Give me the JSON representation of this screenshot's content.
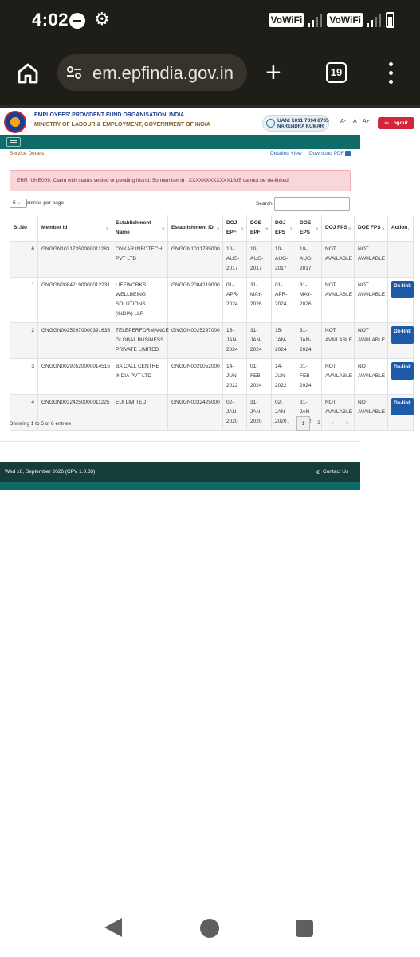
{
  "status_bar": {
    "time": "4:02",
    "network1": "VoWiFi",
    "network2": "VoWiFi"
  },
  "browser": {
    "url": "em.epfindia.gov.in",
    "tab_count": "19"
  },
  "site_header": {
    "org_line1": "EMPLOYEES' PROVIDENT FUND ORGANISATION, INDIA",
    "org_line2": "MINISTRY OF LABOUR & EMPLOYMENT, GOVERNMENT OF INDIA",
    "uan": "UAN: 1011 7094 8705",
    "user_name": "NARENDRA KUMAR",
    "font_small": "A-",
    "font_normal": "A",
    "font_large": "A+",
    "logout": "Logout"
  },
  "page": {
    "title": "Service Details",
    "detailed_view": "Detailed View",
    "download_pdf": "Download PDF",
    "error": "ERR_UNE009: Claim with status settled or pending found. So member id : XXXXXXXXXXXX1635 cannot be de-linked.",
    "entries_value": "5",
    "entries_label": "entries per page",
    "search_label": "Search:",
    "info": "Showing 1 to 5 of 6 entries"
  },
  "table": {
    "headers": {
      "srno": "Sr.No",
      "member_id": "Member Id",
      "est_name": "Establishment Name",
      "est_id": "Establishment ID",
      "doj_epf": "DOJ EPF",
      "doe_epf": "DOE EPF",
      "doj_eps": "DOJ EPS",
      "doe_eps": "DOE EPS",
      "doj_fps": "DOJ FPS",
      "doe_fps": "DOE FPS",
      "action": "Action"
    },
    "delink_label": "De-link",
    "rows": [
      {
        "sr": "6",
        "member_id": "GNGGN10317350000011283",
        "est_name": "ONKAR INFOTECH PVT LTD",
        "est_id": "GNGGN1031735000",
        "doj_epf": "10-AUG-2017",
        "doe_epf": "10-AUG-2017",
        "doj_eps": "10-AUG-2017",
        "doe_eps": "10-AUG-2017",
        "doj_fps": "NOT AVAILABLE",
        "doe_fps": "NOT AVAILABLE"
      },
      {
        "sr": "1",
        "member_id": "GNGGN20842190000012231",
        "est_name": "LIFEWORKS WELLBEING SOLUTIONS (INDIA) LLP",
        "est_id": "GNGGN2084219000",
        "doj_epf": "01-APR-2024",
        "doe_epf": "31-MAY-2026",
        "doj_eps": "01-APR-2024",
        "doe_eps": "31-MAY-2026",
        "doj_fps": "NOT AVAILABLE",
        "doe_fps": "NOT AVAILABLE"
      },
      {
        "sr": "2",
        "member_id": "GNGGN00252970000391635",
        "est_name": "TELEPERFORMANCE GLOBAL BUSINESS PRIVATE LIMITED",
        "est_id": "GNGGN0025297000",
        "doj_epf": "15-JAN-2024",
        "doe_epf": "31-JAN-2024",
        "doj_eps": "15-JAN-2024",
        "doe_eps": "31-JAN-2024",
        "doj_fps": "NOT AVAILABLE",
        "doe_fps": "NOT AVAILABLE"
      },
      {
        "sr": "3",
        "member_id": "GNGGN00290520000014515",
        "est_name": "BA CALL CENTRE INDIA PVT LTD",
        "est_id": "GNGGN0029052000",
        "doj_epf": "14-JUN-2022",
        "doe_epf": "01-FEB-2024",
        "doj_eps": "14-JUN-2022",
        "doe_eps": "01-FEB-2024",
        "doj_fps": "NOT AVAILABLE",
        "doe_fps": "NOT AVAILABLE"
      },
      {
        "sr": "4",
        "member_id": "GNGGN00324250000011225",
        "est_name": "EUI LIMITED",
        "est_id": "GNGGN0032425000",
        "doj_epf": "02-JAN-2020",
        "doe_epf": "31-JAN-2020",
        "doj_eps": "02-JAN-2020",
        "doe_eps": "31-JAN-2022",
        "doj_fps": "NOT AVAILABLE",
        "doe_fps": "NOT AVAILABLE"
      }
    ]
  },
  "pager": {
    "first": "«",
    "prev": "‹",
    "page1": "1",
    "page2": "2",
    "next": "›",
    "last": "»"
  },
  "footer": {
    "date": "Wed 16, September 2026 (CPV 1.0.33)",
    "contact": "Contact Us"
  }
}
